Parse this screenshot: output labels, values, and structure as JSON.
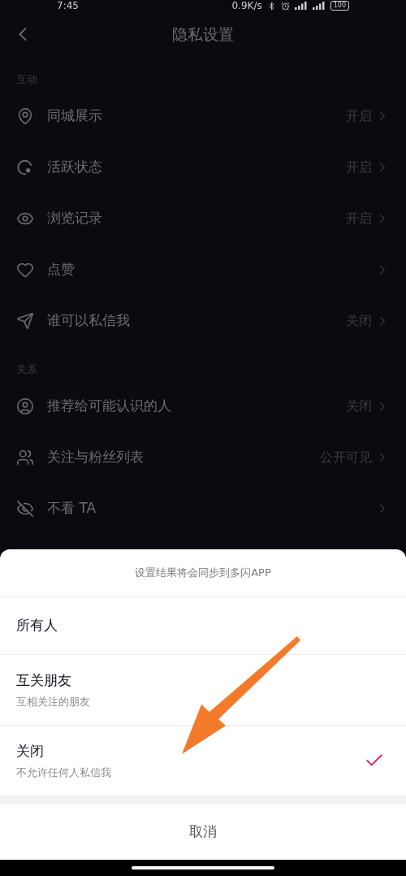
{
  "status_bar": {
    "time": "7:45",
    "speed": "0.9K/s",
    "battery": "100"
  },
  "header": {
    "title": "隐私设置"
  },
  "sections": [
    {
      "title": "互动",
      "items": [
        {
          "label": "同城展示",
          "value": "开启"
        },
        {
          "label": "活跃状态",
          "value": "开启"
        },
        {
          "label": "浏览记录",
          "value": "开启"
        },
        {
          "label": "点赞"
        },
        {
          "label": "谁可以私信我",
          "value": "关闭"
        }
      ]
    },
    {
      "title": "关系",
      "items": [
        {
          "label": "推荐给可能认识的人",
          "value": "关闭"
        },
        {
          "label": "关注与粉丝列表",
          "value": "公开可见"
        },
        {
          "label": "不看 TA"
        }
      ]
    }
  ],
  "sheet": {
    "note": "设置结果将会同步到多闪APP",
    "options": [
      {
        "label": "所有人",
        "selected": false
      },
      {
        "label": "互关朋友",
        "description": "互相关注的朋友",
        "selected": false
      },
      {
        "label": "关闭",
        "description": "不允许任何人私信我",
        "selected": true
      }
    ],
    "cancel": "取消"
  }
}
